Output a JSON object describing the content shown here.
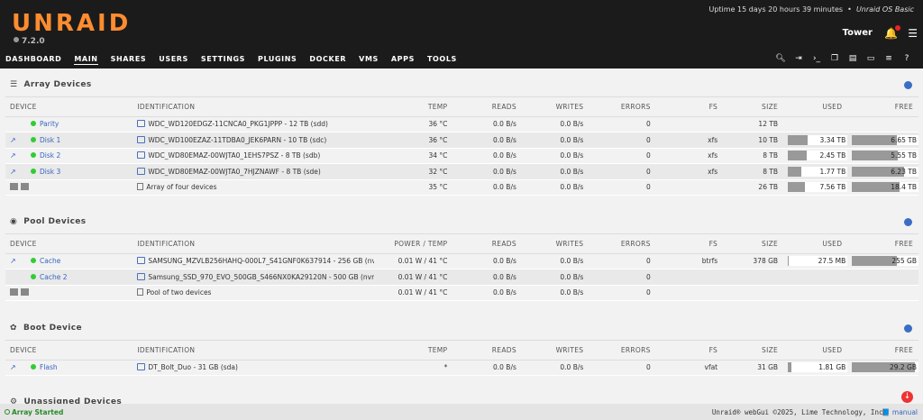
{
  "header": {
    "logo": "UNRAID",
    "version": "7.2.0",
    "uptime": "Uptime 15 days 20 hours 39 minutes",
    "os": "Unraid OS Basic",
    "server_name": "Tower"
  },
  "nav": [
    "DASHBOARD",
    "MAIN",
    "SHARES",
    "USERS",
    "SETTINGS",
    "PLUGINS",
    "DOCKER",
    "VMS",
    "APPS",
    "TOOLS"
  ],
  "array": {
    "title": "Array Devices",
    "columns": [
      "DEVICE",
      "IDENTIFICATION",
      "TEMP",
      "READS",
      "WRITES",
      "ERRORS",
      "FS",
      "SIZE",
      "USED",
      "FREE"
    ],
    "rows": [
      {
        "device": "Parity",
        "id": "WDC_WD120EDGZ-11CNCA0_PKG1JPPP - 12 TB (sdd)",
        "temp": "36 °C",
        "reads": "0.0 B/s",
        "writes": "0.0 B/s",
        "errors": "0",
        "fs": "",
        "size": "12 TB",
        "used": "",
        "used_pct": 0,
        "free": "",
        "free_pct": 0
      },
      {
        "device": "Disk 1",
        "id": "WDC_WD100EZAZ-11TDBA0_JEK6PARN - 10 TB (sdc)",
        "temp": "36 °C",
        "reads": "0.0 B/s",
        "writes": "0.0 B/s",
        "errors": "0",
        "fs": "xfs",
        "size": "10 TB",
        "used": "3.34 TB",
        "used_pct": 33,
        "free": "6.65 TB",
        "free_pct": 67
      },
      {
        "device": "Disk 2",
        "id": "WDC_WD80EMAZ-00WJTA0_1EHS7PSZ - 8 TB (sdb)",
        "temp": "34 °C",
        "reads": "0.0 B/s",
        "writes": "0.0 B/s",
        "errors": "0",
        "fs": "xfs",
        "size": "8 TB",
        "used": "2.45 TB",
        "used_pct": 31,
        "free": "5.55 TB",
        "free_pct": 69
      },
      {
        "device": "Disk 3",
        "id": "WDC_WD80EMAZ-00WJTA0_7HJZNAWF - 8 TB (sde)",
        "temp": "32 °C",
        "reads": "0.0 B/s",
        "writes": "0.0 B/s",
        "errors": "0",
        "fs": "xfs",
        "size": "8 TB",
        "used": "1.77 TB",
        "used_pct": 22,
        "free": "6.23 TB",
        "free_pct": 78
      },
      {
        "device": "",
        "id": "Array of four devices",
        "temp": "35 °C",
        "reads": "0.0 B/s",
        "writes": "0.0 B/s",
        "errors": "0",
        "fs": "",
        "size": "26 TB",
        "used": "7.56 TB",
        "used_pct": 29,
        "free": "18.4 TB",
        "free_pct": 71
      }
    ]
  },
  "pool": {
    "title": "Pool Devices",
    "columns": [
      "DEVICE",
      "IDENTIFICATION",
      "POWER / TEMP",
      "READS",
      "WRITES",
      "ERRORS",
      "FS",
      "SIZE",
      "USED",
      "FREE"
    ],
    "rows": [
      {
        "device": "Cache",
        "id": "SAMSUNG_MZVLB256HAHQ-000L7_S41GNF0K637914 - 256 GB (nvme…",
        "temp": "0.01 W / 41 °C",
        "reads": "0.0 B/s",
        "writes": "0.0 B/s",
        "errors": "0",
        "fs": "btrfs",
        "size": "378 GB",
        "used": "27.5 MB",
        "used_pct": 1,
        "free": "255 GB",
        "free_pct": 67
      },
      {
        "device": "Cache 2",
        "id": "Samsung_SSD_970_EVO_500GB_S466NX0KA29120N - 500 GB (nvme…",
        "temp": "0.01 W / 41 °C",
        "reads": "0.0 B/s",
        "writes": "0.0 B/s",
        "errors": "0",
        "fs": "",
        "size": "",
        "used": "",
        "used_pct": 0,
        "free": "",
        "free_pct": 0
      },
      {
        "device": "",
        "id": "Pool of two devices",
        "temp": "0.01 W / 41 °C",
        "reads": "0.0 B/s",
        "writes": "0.0 B/s",
        "errors": "0",
        "fs": "",
        "size": "",
        "used": "",
        "used_pct": 0,
        "free": "",
        "free_pct": 0
      }
    ]
  },
  "boot": {
    "title": "Boot Device",
    "columns": [
      "DEVICE",
      "IDENTIFICATION",
      "TEMP",
      "READS",
      "WRITES",
      "ERRORS",
      "FS",
      "SIZE",
      "USED",
      "FREE"
    ],
    "rows": [
      {
        "device": "Flash",
        "id": "DT_Bolt_Duo - 31 GB (sda)",
        "temp": "*",
        "reads": "0.0 B/s",
        "writes": "0.0 B/s",
        "errors": "0",
        "fs": "vfat",
        "size": "31 GB",
        "used": "1.81 GB",
        "used_pct": 6,
        "free": "29.2 GB",
        "free_pct": 94
      }
    ]
  },
  "unassigned": {
    "title": "Unassigned Devices"
  },
  "footer": {
    "status": "Array Started",
    "copyright": "Unraid® webGui ©2025, Lime Technology, Inc.",
    "manual": "manual"
  }
}
